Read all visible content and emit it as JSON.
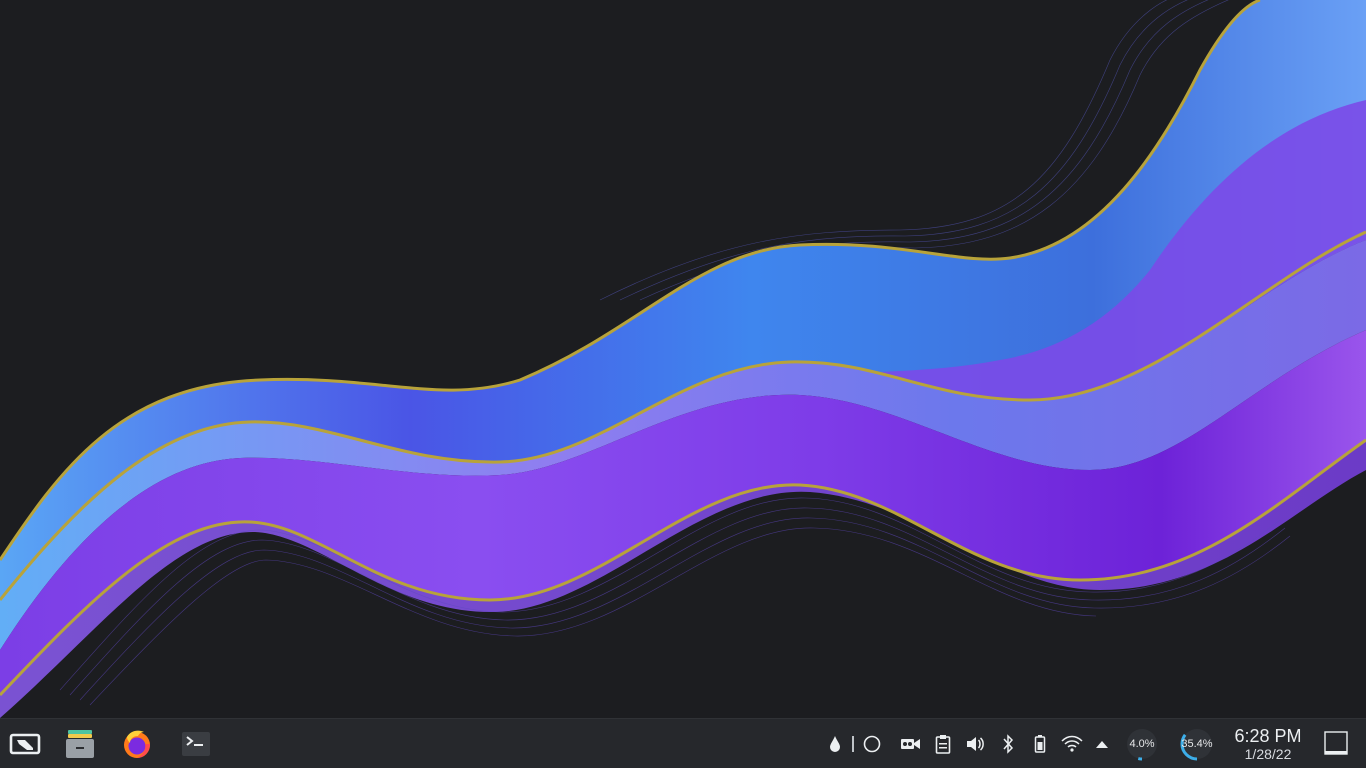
{
  "taskbar": {
    "launchers": [
      {
        "name": "Steam Deck Return to Gaming Mode",
        "icon": "gaming-mode-icon"
      },
      {
        "name": "Dolphin File Manager",
        "icon": "file-manager-icon"
      },
      {
        "name": "Firefox",
        "icon": "firefox-icon"
      },
      {
        "name": "Konsole",
        "icon": "terminal-icon"
      }
    ],
    "tray_icons": [
      "drop-icon",
      "separator",
      "circle-icon",
      "video-icon",
      "clipboard-icon",
      "volume-icon",
      "bluetooth-icon",
      "battery-icon",
      "wifi-icon",
      "expand-tray-icon"
    ],
    "cpu_load": {
      "label": "4.0%",
      "value": 0.04,
      "color": "#3daee9"
    },
    "memory_load": {
      "label": "35.4%",
      "value": 0.354,
      "color": "#3daee9"
    },
    "clock": {
      "time": "6:28 PM",
      "date": "1/28/22"
    }
  },
  "colors": {
    "desktop_bg": "#1c1d20",
    "taskbar_bg": "#26282c",
    "wave_blue": "#4f8ef0",
    "wave_purple": "#8a3ae6",
    "wave_edge_gold": "#b8a33a"
  }
}
